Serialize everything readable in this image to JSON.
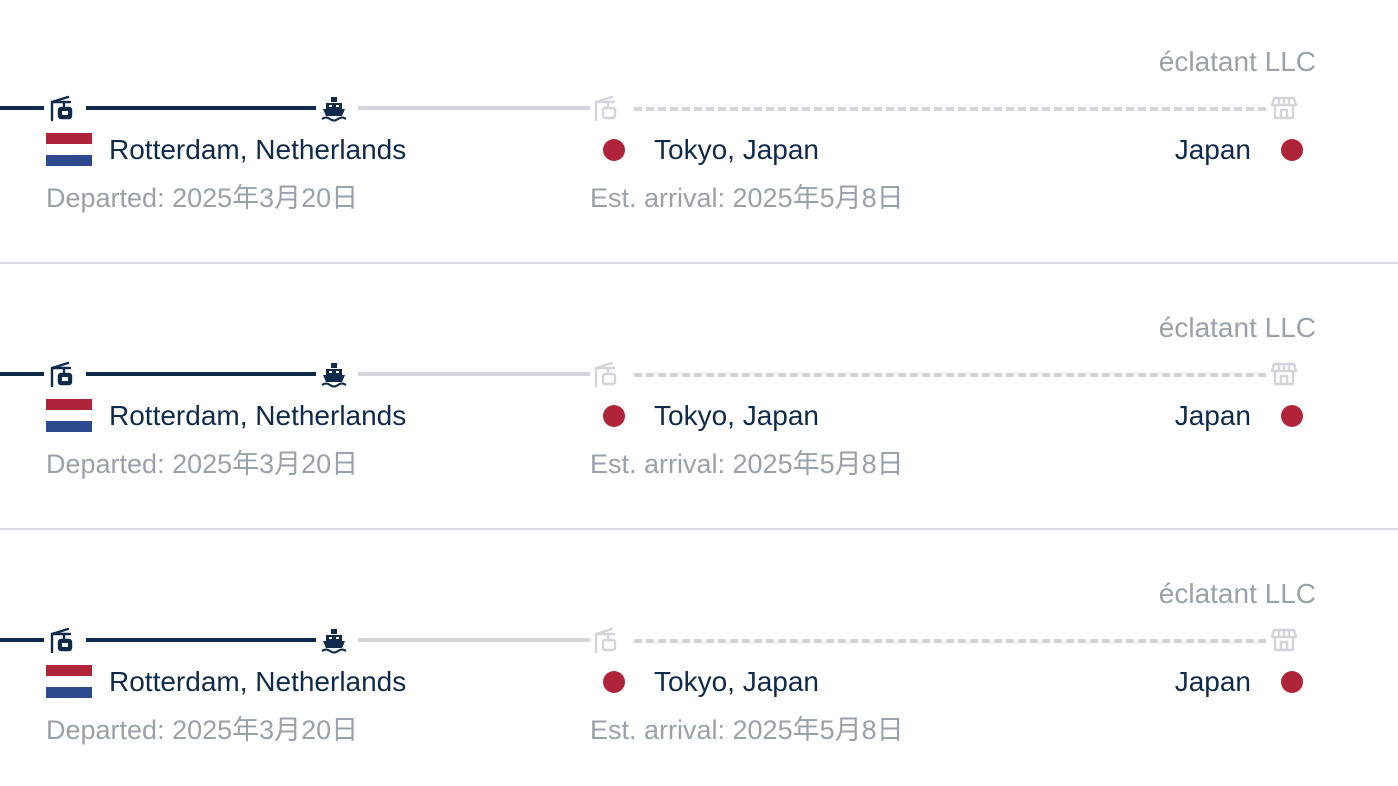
{
  "colors": {
    "primary_navy": "#0f2a4a",
    "muted_gray": "#9aa1ab",
    "pending_line": "#d3d5db",
    "japan_red": "#b0243a",
    "divider": "#d9dce1"
  },
  "icons": {
    "origin_port": "port-crane-icon",
    "vessel": "ship-icon",
    "destination_port": "port-crane-icon",
    "final_destination": "store-icon"
  },
  "shipments": [
    {
      "company": "éclatant LLC",
      "origin": "Rotterdam, Netherlands",
      "departed": "Departed: 2025年3月20日",
      "destination_port": "Tokyo, Japan",
      "est_arrival": "Est. arrival: 2025年5月8日",
      "final_destination": "Japan"
    },
    {
      "company": "éclatant LLC",
      "origin": "Rotterdam, Netherlands",
      "departed": "Departed: 2025年3月20日",
      "destination_port": "Tokyo, Japan",
      "est_arrival": "Est. arrival: 2025年5月8日",
      "final_destination": "Japan"
    },
    {
      "company": "éclatant LLC",
      "origin": "Rotterdam, Netherlands",
      "departed": "Departed: 2025年3月20日",
      "destination_port": "Tokyo, Japan",
      "est_arrival": "Est. arrival: 2025年5月8日",
      "final_destination": "Japan"
    }
  ]
}
